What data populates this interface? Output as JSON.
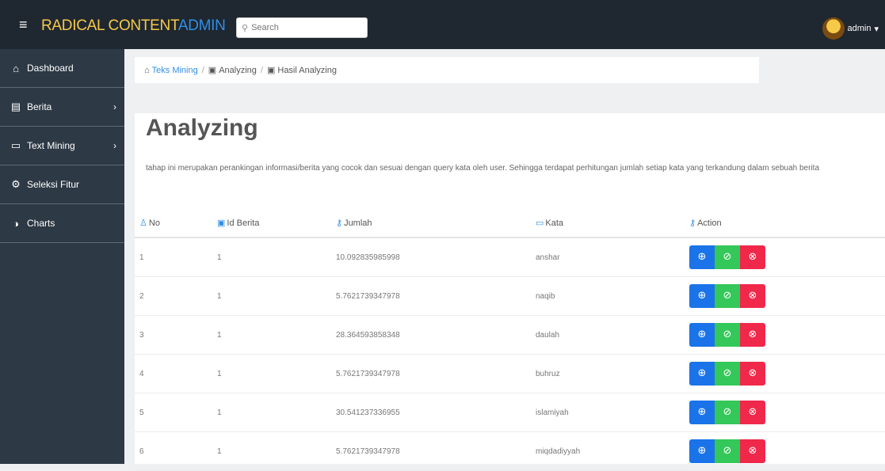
{
  "header": {
    "brand_part1": "RADICAL CONTENT",
    "brand_part2": "ADMIN",
    "search_placeholder": "Search",
    "user_name": "admin",
    "user_caret": "▾"
  },
  "sidebar": {
    "items": [
      {
        "label": "Dashboard",
        "icon": "home-icon"
      },
      {
        "label": "Berita",
        "icon": "newspaper-icon",
        "has_children": true
      },
      {
        "label": "Text Mining",
        "icon": "monitor-icon",
        "has_children": true
      },
      {
        "label": "Seleksi Fitur",
        "icon": "gear-icon"
      },
      {
        "label": "Charts",
        "icon": "pie-chart-icon"
      }
    ]
  },
  "breadcrumb": {
    "items": [
      "Teks Mining",
      "Analyzing",
      "Hasil Analyzing"
    ]
  },
  "page": {
    "title": "Analyzing",
    "description": "tahap ini merupakan perankingan informasi/berita yang cocok dan sesuai dengan query kata oleh user. Sehingga terdapat perhitungan jumlah setiap kata yang terkandung dalam sebuah berita"
  },
  "table": {
    "headers": [
      "No",
      "Id Berita",
      "Jumlah",
      "Kata",
      "Action"
    ],
    "rows": [
      {
        "no": "1",
        "id_berita": "1",
        "jumlah": "10.092835985998",
        "kata": "anshar"
      },
      {
        "no": "2",
        "id_berita": "1",
        "jumlah": "5.7621739347978",
        "kata": "naqib"
      },
      {
        "no": "3",
        "id_berita": "1",
        "jumlah": "28.364593858348",
        "kata": "daulah"
      },
      {
        "no": "4",
        "id_berita": "1",
        "jumlah": "5.7621739347978",
        "kata": "buhruz"
      },
      {
        "no": "5",
        "id_berita": "1",
        "jumlah": "30.541237336955",
        "kata": "islamiyah"
      },
      {
        "no": "6",
        "id_berita": "1",
        "jumlah": "5.7621739347978",
        "kata": "miqdadiyyah"
      }
    ]
  },
  "colors": {
    "topbar": "#1f2730",
    "sidebar": "#2d3945",
    "brand_yellow": "#f7c948",
    "brand_blue": "#2f8ee6",
    "btn_blue": "#1a73e8",
    "btn_green": "#34c759",
    "btn_red": "#f0284a"
  }
}
